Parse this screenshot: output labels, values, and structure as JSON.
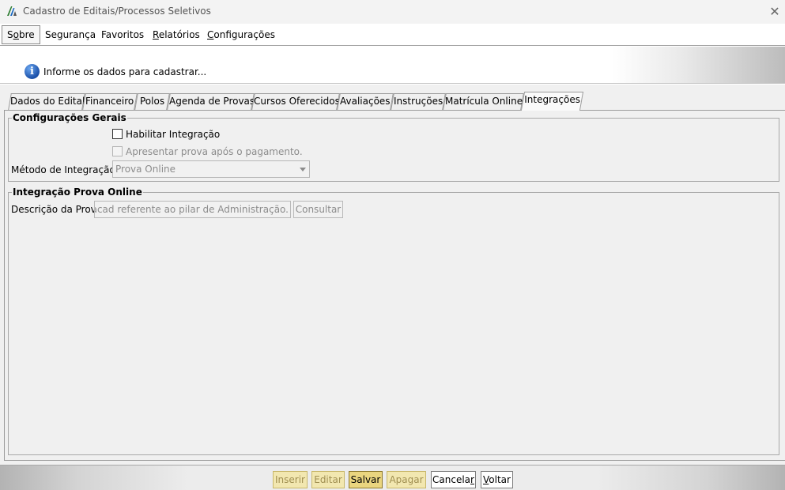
{
  "window": {
    "title": "Cadastro de Editais/Processos Seletivos"
  },
  "menu": [
    {
      "pre": "S",
      "key": "o",
      "post": "bre",
      "active": true
    },
    {
      "pre": "Segurança",
      "key": "",
      "post": "",
      "active": false
    },
    {
      "pre": "Favoritos",
      "key": "",
      "post": "",
      "active": false
    },
    {
      "pre": "",
      "key": "R",
      "post": "elatórios",
      "active": false
    },
    {
      "pre": "",
      "key": "C",
      "post": "onfigurações",
      "active": false
    }
  ],
  "banner": {
    "message": "Informe os dados para cadastrar..."
  },
  "tabs": [
    {
      "label": "Dados do Edital",
      "active": false
    },
    {
      "label": "Financeiro",
      "active": false
    },
    {
      "label": "Polos",
      "active": false
    },
    {
      "label": "Agenda de Provas",
      "active": false
    },
    {
      "label": "Cursos Oferecidos",
      "active": false
    },
    {
      "label": "Avaliações",
      "active": false
    },
    {
      "label": "Instruções",
      "active": false
    },
    {
      "label": "Matrícula Online",
      "active": false
    },
    {
      "label": "Integrações",
      "active": true
    }
  ],
  "config_gerais": {
    "legend": "Configurações Gerais",
    "habilitar_label": "Habilitar Integração",
    "apresentar_label": "Apresentar prova após o pagamento.",
    "metodo_label": "Método de Integração:",
    "metodo_value": "Prova Online"
  },
  "prova_online": {
    "legend": "Integração Prova Online",
    "descricao_label": "Descrição da Prova:",
    "descricao_value": "ema Jacad referente ao pilar de Administração.",
    "consultar_label": "Consultar"
  },
  "actions": [
    {
      "pre": "Inserir",
      "key": "",
      "post": "",
      "state": "disabled"
    },
    {
      "pre": "Editar",
      "key": "",
      "post": "",
      "state": "disabled"
    },
    {
      "pre": "Salvar",
      "key": "",
      "post": "",
      "state": "primary"
    },
    {
      "pre": "Apagar",
      "key": "",
      "post": "",
      "state": "disabled"
    },
    {
      "pre": "Cancela",
      "key": "r",
      "post": "",
      "state": "normal"
    },
    {
      "pre": "",
      "key": "V",
      "post": "oltar",
      "state": "normal"
    }
  ],
  "colors": {
    "accent_button": "#ead57f",
    "disabled_button": "#f2e7b0",
    "info_icon": "#1a4fa8"
  }
}
